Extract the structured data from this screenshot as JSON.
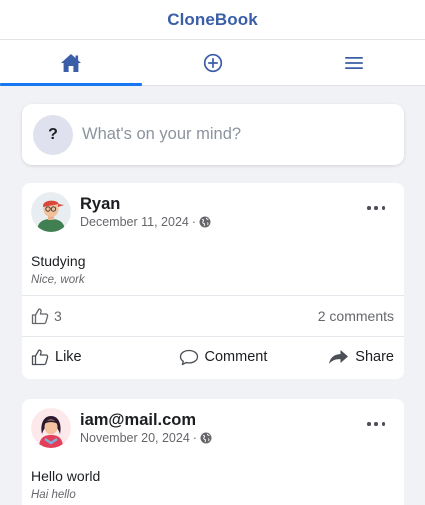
{
  "app": {
    "title": "CloneBook"
  },
  "tabs": [
    {
      "name": "home",
      "icon": "home-icon",
      "active": true
    },
    {
      "name": "create",
      "icon": "plus-circle-icon",
      "active": false
    },
    {
      "name": "menu",
      "icon": "menu-icon",
      "active": false
    }
  ],
  "composer": {
    "avatar_text": "?",
    "placeholder": "What's on your mind?"
  },
  "posts": [
    {
      "author": "Ryan",
      "date": "December 11, 2024",
      "separator": "·",
      "visibility_icon": "globe-icon",
      "title": "Studying",
      "subtitle": "Nice, work",
      "likes": "3",
      "comments": "2 comments",
      "actions": {
        "like": "Like",
        "comment": "Comment",
        "share": "Share"
      }
    },
    {
      "author": "iam@mail.com",
      "date": "November 20, 2024",
      "separator": "·",
      "visibility_icon": "globe-icon",
      "title": "Hello world",
      "subtitle": "Hai hello"
    }
  ],
  "colors": {
    "brand": "#3b5ea8",
    "active_tab": "#1877f2",
    "background": "#f0f2f5",
    "muted_text": "#65676b"
  }
}
